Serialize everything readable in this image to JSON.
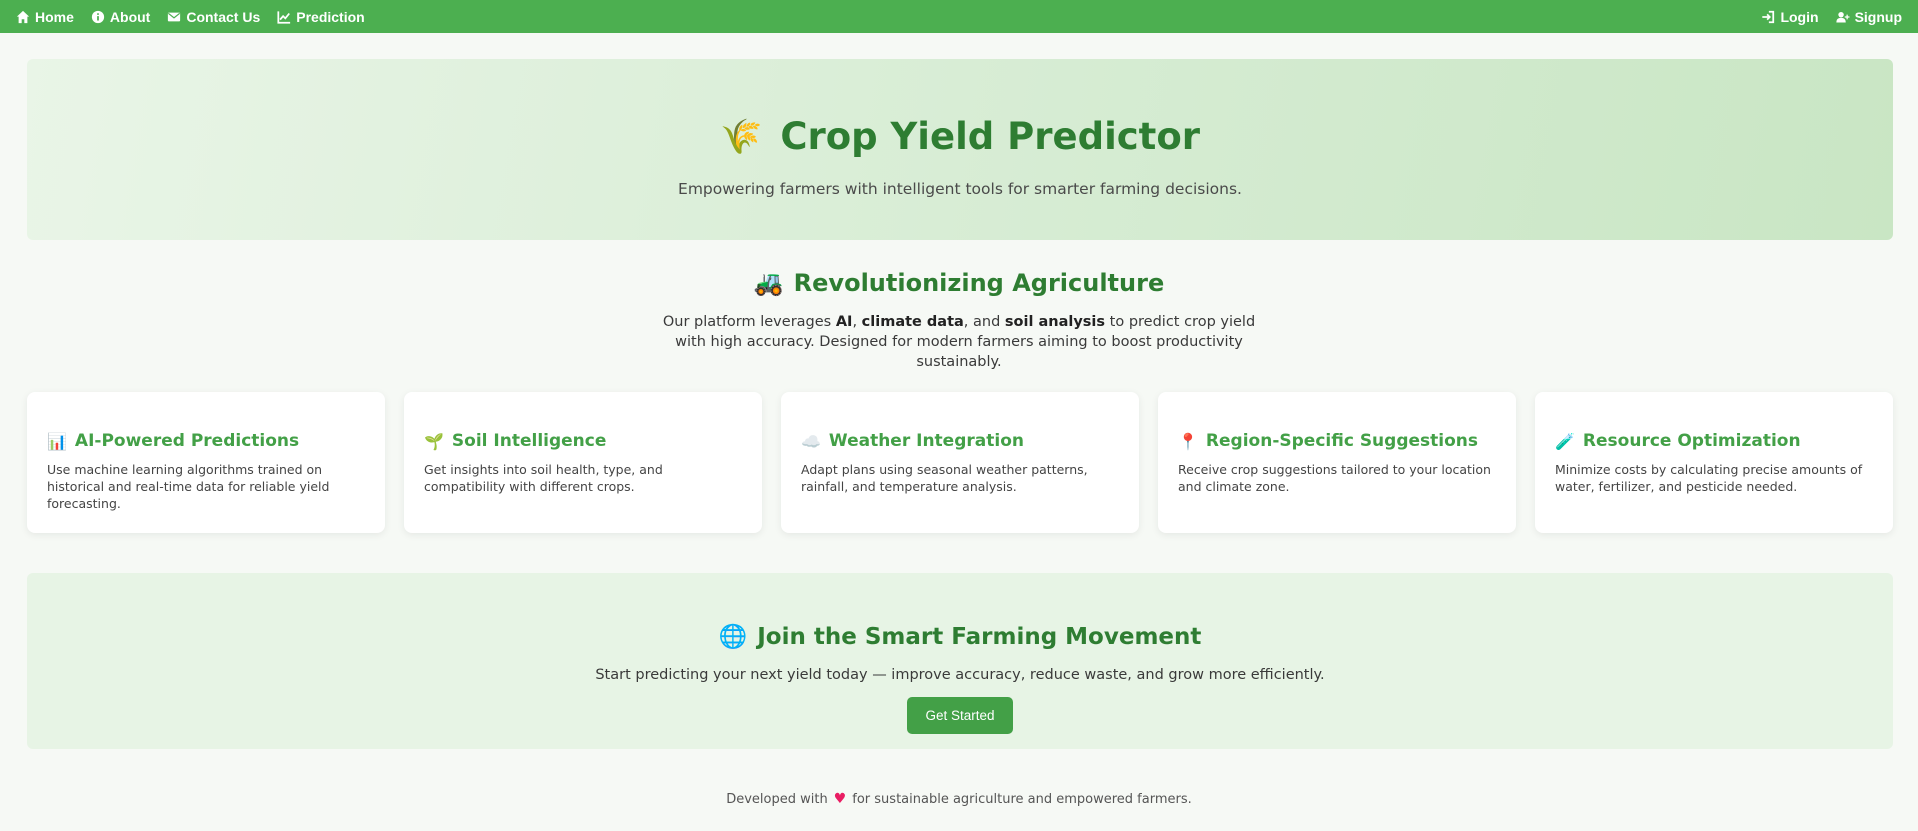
{
  "nav": {
    "left": [
      {
        "label": "Home",
        "icon": "home-icon"
      },
      {
        "label": "About",
        "icon": "info-icon"
      },
      {
        "label": "Contact Us",
        "icon": "envelope-icon"
      },
      {
        "label": "Prediction",
        "icon": "chart-line-icon"
      }
    ],
    "right": [
      {
        "label": "Login",
        "icon": "login-icon"
      },
      {
        "label": "Signup",
        "icon": "user-plus-icon"
      }
    ],
    "bar_color": "#4caf50"
  },
  "hero": {
    "emoji": "🌾",
    "title": "Crop Yield Predictor",
    "subtitle": "Empowering farmers with intelligent tools for smarter farming decisions."
  },
  "revolution": {
    "emoji": "🚜",
    "title": "Revolutionizing Agriculture",
    "text_1": "Our platform leverages ",
    "bold_1": "AI",
    "text_2": ", ",
    "bold_2": "climate data",
    "text_3": ", and ",
    "bold_3": "soil analysis",
    "text_4": " to predict crop yield with high accuracy. Designed for modern farmers aiming to boost productivity sustainably."
  },
  "features": [
    {
      "emoji": "📊",
      "title": "AI-Powered Predictions",
      "desc": "Use machine learning algorithms trained on historical and real-time data for reliable yield forecasting."
    },
    {
      "emoji": "🌱",
      "title": "Soil Intelligence",
      "desc": "Get insights into soil health, type, and compatibility with different crops."
    },
    {
      "emoji": "☁️",
      "title": "Weather Integration",
      "desc": "Adapt plans using seasonal weather patterns, rainfall, and temperature analysis."
    },
    {
      "emoji": "📍",
      "title": "Region-Specific Suggestions",
      "desc": "Receive crop suggestions tailored to your location and climate zone."
    },
    {
      "emoji": "🧪",
      "title": "Resource Optimization",
      "desc": "Minimize costs by calculating precise amounts of water, fertilizer, and pesticide needed."
    }
  ],
  "join": {
    "emoji": "🌐",
    "title": "Join the Smart Farming Movement",
    "text": "Start predicting your next yield today — improve accuracy, reduce waste, and grow more efficiently.",
    "button": "Get Started"
  },
  "footer": {
    "before": "Developed with",
    "heart": "♥",
    "after": "for sustainable agriculture and empowered farmers."
  },
  "colors": {
    "accent": "#4caf50",
    "heading_green": "#2e7d32",
    "card_title_green": "#43a047"
  }
}
